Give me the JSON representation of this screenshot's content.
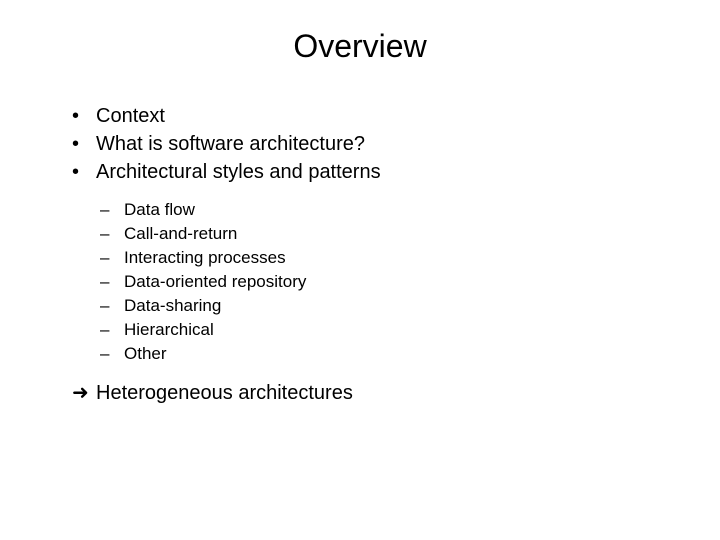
{
  "title": "Overview",
  "bullets": {
    "b0": "Context",
    "b1": "What is software architecture?",
    "b2": "Architectural styles and patterns"
  },
  "sub": {
    "s0": "Data flow",
    "s1": "Call-and-return",
    "s2": "Interacting processes",
    "s3": "Data-oriented repository",
    "s4": "Data-sharing",
    "s5": "Hierarchical",
    "s6": "Other"
  },
  "arrow_item": "Heterogeneous architectures",
  "arrow_glyph": "➜"
}
